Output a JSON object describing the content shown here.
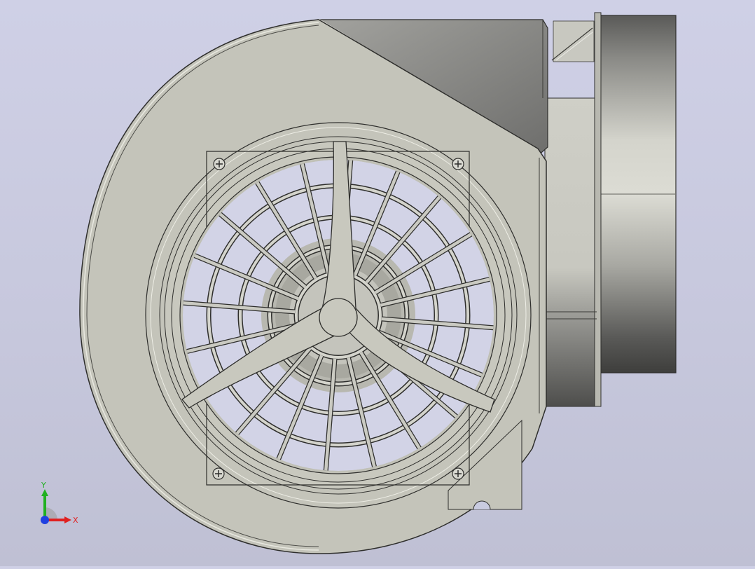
{
  "viewport": {
    "background_top": "#cfd0e6",
    "background_bottom": "#bfc0d4",
    "model": "centrifugal-blower-with-finger-guard"
  },
  "triad": {
    "x_label": "X",
    "y_label": "Y",
    "x_color": "#e02020",
    "y_color": "#20b020",
    "z_color": "#2040e0"
  },
  "colors": {
    "housing": "#c2c2b8",
    "housing_light": "#d0d0c6",
    "edge": "#3a3a36",
    "outlet_dark": "#6a6a68",
    "outlet_mid": "#9a9a96",
    "motor_light": "#d9d9d2",
    "motor_dark": "#4a4a48"
  },
  "icons": [
    "screw-icon",
    "screw-icon",
    "screw-icon",
    "screw-icon",
    "coordinate-triad-icon"
  ]
}
